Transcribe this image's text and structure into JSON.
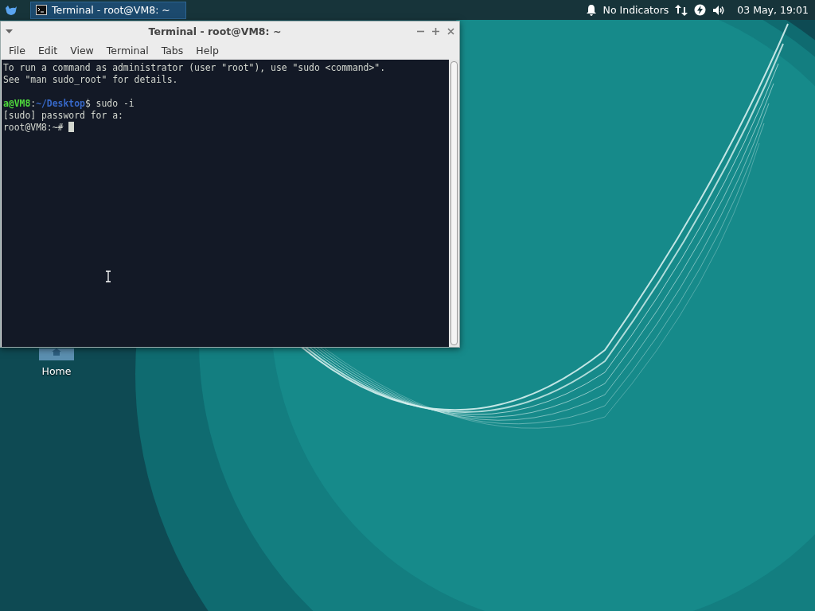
{
  "panel": {
    "tasks": [
      {
        "label": "Terminal - root@VM8: ~",
        "selected": true
      }
    ],
    "indicator_text": "No Indicators",
    "clock": "03 May, 19:01"
  },
  "desktop_icons": [
    {
      "label": "Home"
    }
  ],
  "window": {
    "title": "Terminal - root@VM8: ~",
    "menu": [
      "File",
      "Edit",
      "View",
      "Terminal",
      "Tabs",
      "Help"
    ],
    "paragraphs": [
      {
        "lines": [
          {
            "cursor": false,
            "segments": [
              {
                "kind": "plain",
                "text": "To run a command as administrator (user \"root\"), use \"sudo <command>\"."
              }
            ]
          },
          {
            "cursor": false,
            "segments": [
              {
                "kind": "plain",
                "text": "See \"man sudo_root\" for details."
              }
            ]
          }
        ]
      },
      {
        "lines": [
          {
            "cursor": false,
            "segments": [
              {
                "kind": "user",
                "text": "a@VM8"
              },
              {
                "kind": "plain",
                "text": ":"
              },
              {
                "kind": "path",
                "text": "~/Desktop"
              },
              {
                "kind": "plain",
                "text": "$ sudo -i"
              }
            ]
          },
          {
            "cursor": false,
            "segments": [
              {
                "kind": "plain",
                "text": "[sudo] password for a:"
              }
            ]
          },
          {
            "cursor": true,
            "segments": [
              {
                "kind": "plain",
                "text": "root@VM8:~# "
              }
            ]
          }
        ]
      }
    ]
  }
}
